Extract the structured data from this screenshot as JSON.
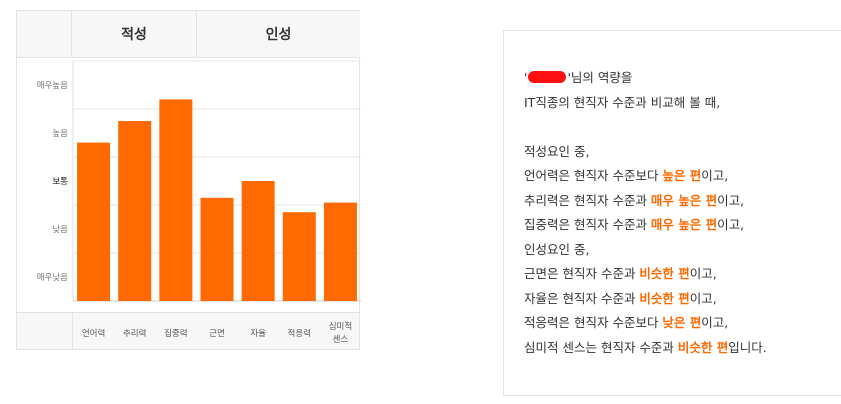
{
  "chart_data": {
    "type": "bar",
    "groups": [
      {
        "label": "적성",
        "categories": [
          "언어력",
          "추리력",
          "집중력"
        ]
      },
      {
        "label": "인성",
        "categories": [
          "근면",
          "자율",
          "적응력",
          "심미적\n센스"
        ]
      }
    ],
    "categories": [
      "언어력",
      "추리력",
      "집중력",
      "근면",
      "자율",
      "적응력",
      "심미적\n센스"
    ],
    "values": [
      3.3,
      3.75,
      4.2,
      2.15,
      2.5,
      1.85,
      2.05
    ],
    "y_levels": [
      "매우낮음",
      "낮음",
      "보통",
      "높음",
      "매우높음"
    ],
    "ylim": [
      0,
      5
    ],
    "bar_color": "#ff6a00",
    "grid": true
  },
  "summary": {
    "lines": [
      [
        {
          "t": "'",
          "h": false
        },
        {
          "redacted": true
        },
        {
          "t": "'님의 역량을",
          "h": false
        }
      ],
      [
        {
          "t": "IT직종의 현직자 수준과 비교해 볼 때,",
          "h": false
        }
      ],
      [],
      [
        {
          "t": "적성요인 중,",
          "h": false
        }
      ],
      [
        {
          "t": "언어력은 현직자 수준보다 ",
          "h": false
        },
        {
          "t": "높은 편",
          "h": true
        },
        {
          "t": "이고,",
          "h": false
        }
      ],
      [
        {
          "t": "추리력은 현직자 수준과 ",
          "h": false
        },
        {
          "t": "매우 높은 편",
          "h": true
        },
        {
          "t": "이고,",
          "h": false
        }
      ],
      [
        {
          "t": "집중력은 현직자 수준과 ",
          "h": false
        },
        {
          "t": "매우 높은 편",
          "h": true
        },
        {
          "t": "이고,",
          "h": false
        }
      ],
      [
        {
          "t": "인성요인 중,",
          "h": false
        }
      ],
      [
        {
          "t": "근면은 현직자 수준과 ",
          "h": false
        },
        {
          "t": "비슷한 편",
          "h": true
        },
        {
          "t": "이고,",
          "h": false
        }
      ],
      [
        {
          "t": "자율은 현직자 수준과 ",
          "h": false
        },
        {
          "t": "비슷한 편",
          "h": true
        },
        {
          "t": "이고,",
          "h": false
        }
      ],
      [
        {
          "t": "적응력은 현직자 수준보다 ",
          "h": false
        },
        {
          "t": "낮은 편",
          "h": true
        },
        {
          "t": "이고,",
          "h": false
        }
      ],
      [
        {
          "t": "심미적 센스는 현직자 수준과 ",
          "h": false
        },
        {
          "t": "비슷한 편",
          "h": true
        },
        {
          "t": "입니다.",
          "h": false
        }
      ]
    ]
  }
}
